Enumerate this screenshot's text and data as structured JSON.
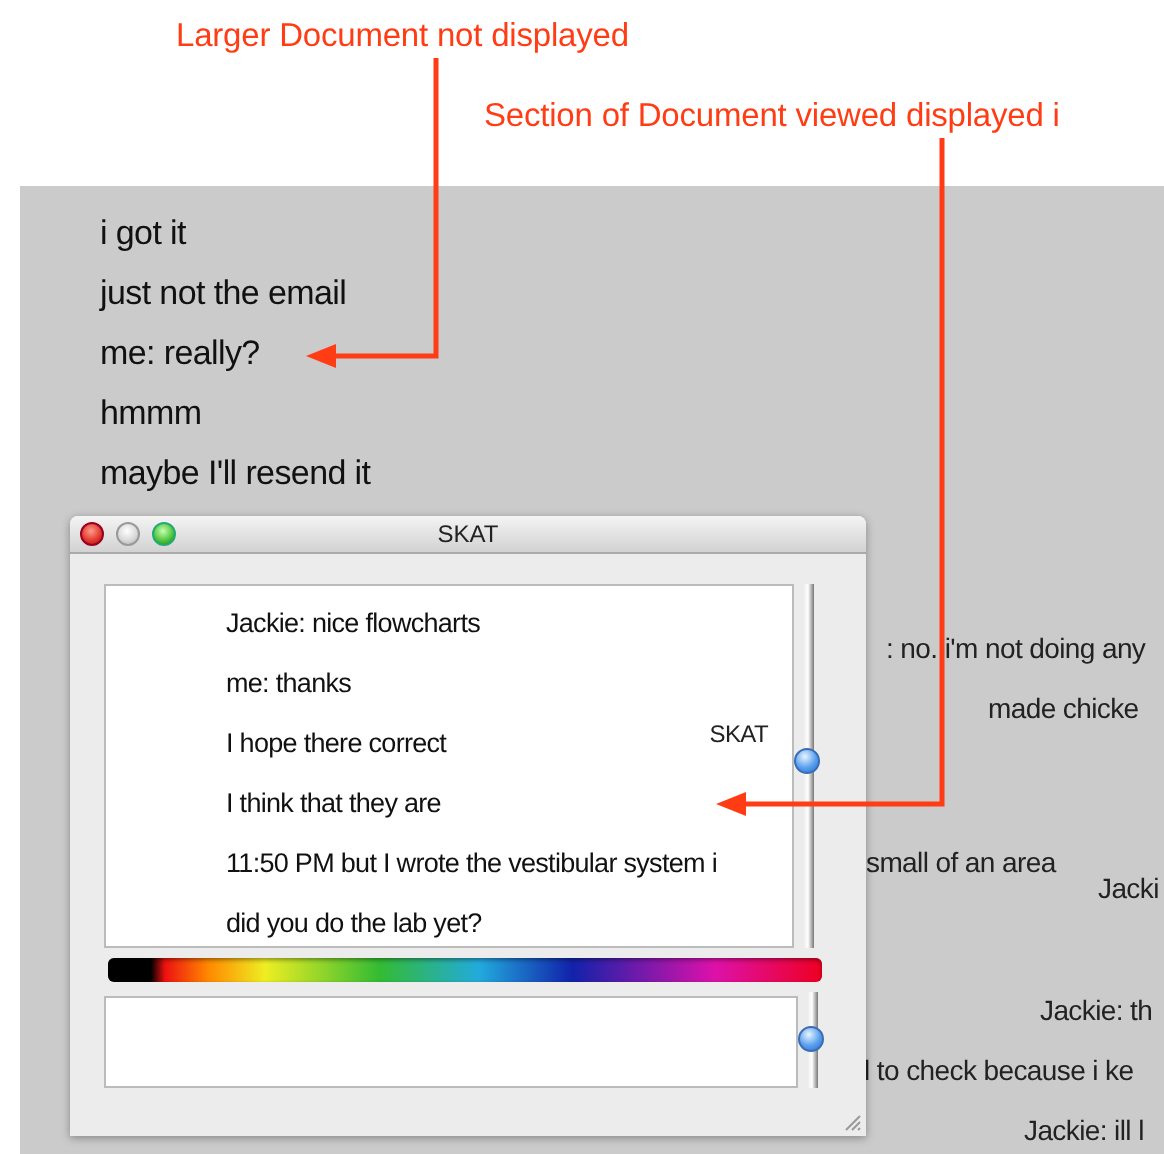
{
  "annotations": [
    {
      "text": "Larger Document not displayed"
    },
    {
      "text": "Section of Document viewed displayed i"
    }
  ],
  "document": {
    "lines": [
      "i got it",
      "just not the email",
      "me: really?",
      "hmmm",
      "maybe I'll resend it"
    ],
    "fragments": [
      ": no. i'm not doing any",
      "made chicke",
      "small of an area",
      "Jacki",
      "Jackie: th",
      "l to check because i ke",
      "Jackie: ill l"
    ]
  },
  "window": {
    "title": "SKAT",
    "side_label": "SKAT",
    "messages": [
      "Jackie: nice flowcharts",
      "me: thanks",
      "I hope there correct",
      "I think that they are",
      "11:50 PM but I wrote the vestibular system i",
      "did you do the lab yet?"
    ]
  }
}
